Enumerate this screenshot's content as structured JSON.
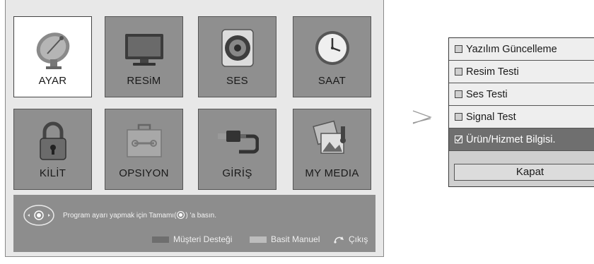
{
  "main_menu": {
    "tiles": [
      {
        "label": "AYAR",
        "icon": "satellite-dish-icon",
        "selected": true
      },
      {
        "label": "RESiM",
        "icon": "monitor-icon",
        "selected": false
      },
      {
        "label": "SES",
        "icon": "speaker-icon",
        "selected": false
      },
      {
        "label": "SAAT",
        "icon": "clock-icon",
        "selected": false
      },
      {
        "label": "KİLİT",
        "icon": "padlock-icon",
        "selected": false
      },
      {
        "label": "OPSIYON",
        "icon": "toolbox-icon",
        "selected": false
      },
      {
        "label": "GİRİŞ",
        "icon": "cable-plug-icon",
        "selected": false
      },
      {
        "label": "MY MEDIA",
        "icon": "media-photos-icon",
        "selected": false
      }
    ]
  },
  "help_bar": {
    "hint_prefix": "Program ayarı yapmak için Tamamı(",
    "hint_suffix": ") 'a basın.",
    "support_label": "Müşteri Desteği",
    "manual_label": "Basit Manuel",
    "exit_label": "Çıkış"
  },
  "separator_glyph": "≥",
  "support_popup": {
    "items": [
      {
        "label": "Yazılım Güncelleme",
        "checked": false,
        "selected": false
      },
      {
        "label": "Resim Testi",
        "checked": false,
        "selected": false
      },
      {
        "label": "Ses Testi",
        "checked": false,
        "selected": false
      },
      {
        "label": "Signal Test",
        "checked": false,
        "selected": false
      },
      {
        "label": "Ürün/Hizmet Bilgisi.",
        "checked": true,
        "selected": true
      }
    ],
    "close_label": "Kapat"
  },
  "colors": {
    "tile_bg": "#8f8f8f",
    "tile_selected_bg": "#ffffff",
    "help_bar_bg": "#8d8d8d",
    "popup_selected_bg": "#6f6f6f"
  }
}
